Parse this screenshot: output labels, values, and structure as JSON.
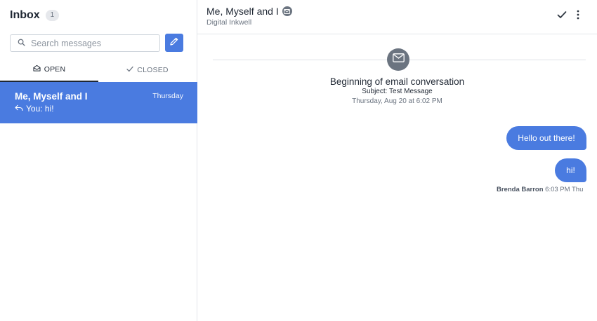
{
  "sidebar": {
    "title": "Inbox",
    "count": "1",
    "search_placeholder": "Search messages",
    "tabs": [
      {
        "label": "OPEN",
        "active": true
      },
      {
        "label": "CLOSED",
        "active": false
      }
    ],
    "conversations": [
      {
        "name": "Me, Myself and I",
        "date": "Thursday",
        "preview": "You: hi!"
      }
    ]
  },
  "conversation": {
    "name": "Me, Myself and I",
    "subtitle": "Digital Inkwell",
    "begin_title": "Beginning of email conversation",
    "subject": "Subject: Test Message",
    "date": "Thursday, Aug 20 at 6:02 PM",
    "messages": [
      {
        "text": "Hello out there!"
      },
      {
        "text": "hi!"
      }
    ],
    "last_sender": "Brenda Barron",
    "last_time": "6:03 PM Thu"
  },
  "colors": {
    "accent": "#4a7be0",
    "muted": "#6b7480"
  },
  "icons": {
    "search": "search-icon",
    "compose": "pencil-icon",
    "open_tab": "open-envelope-icon",
    "closed_tab": "checkmark-icon",
    "reply": "reply-icon",
    "email_channel": "envelope-icon",
    "resolve": "checkmark-icon",
    "more": "vertical-dots-icon"
  }
}
